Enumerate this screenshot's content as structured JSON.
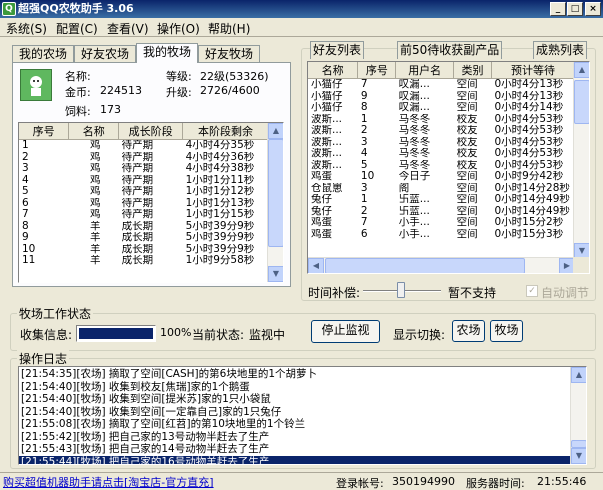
{
  "app": {
    "title": "超强QQ农牧助手 3.06",
    "title_buttons": [
      "_",
      "□",
      "×"
    ]
  },
  "menu": [
    "系统(S)",
    "配置(C)",
    "查看(V)",
    "操作(O)",
    "帮助(H)"
  ],
  "left_tabs": [
    "我的农场",
    "好友农场",
    "我的牧场",
    "好友牧场"
  ],
  "profile": {
    "name_label": "名称:",
    "name_value": "",
    "level_label": "等级:",
    "level_value": "22级(53326)",
    "gold_label": "金币:",
    "gold_value": "224513",
    "upgrade_label": "升级:",
    "upgrade_value": "2726/4600",
    "feed_label": "饲料:",
    "feed_value": "173"
  },
  "animals": {
    "headers": [
      "序号",
      "名称",
      "成长阶段",
      "本阶段剩余"
    ],
    "rows": [
      [
        "1",
        "鸡",
        "待产期",
        "4小时4分35秒"
      ],
      [
        "2",
        "鸡",
        "待产期",
        "4小时4分36秒"
      ],
      [
        "3",
        "鸡",
        "待产期",
        "4小时4分38秒"
      ],
      [
        "4",
        "鸡",
        "待产期",
        "1小时1分11秒"
      ],
      [
        "5",
        "鸡",
        "待产期",
        "1小时1分12秒"
      ],
      [
        "6",
        "鸡",
        "待产期",
        "1小时1分13秒"
      ],
      [
        "7",
        "鸡",
        "待产期",
        "1小时1分15秒"
      ],
      [
        "8",
        "羊",
        "成长期",
        "5小时39分9秒"
      ],
      [
        "9",
        "羊",
        "成长期",
        "5小时39分9秒"
      ],
      [
        "10",
        "羊",
        "成长期",
        "5小时39分9秒"
      ],
      [
        "11",
        "羊",
        "成长期",
        "1小时9分58秒"
      ]
    ]
  },
  "right_tabs": [
    "好友列表",
    "前50待收获副产品",
    "成熟列表"
  ],
  "friends": {
    "headers": [
      "名称",
      "序号",
      "用户名",
      "类别",
      "预计等待"
    ],
    "rows": [
      [
        "小猫仔",
        "7",
        "叹漏...",
        "空间",
        "0小时4分13秒"
      ],
      [
        "小猫仔",
        "9",
        "叹漏...",
        "空间",
        "0小时4分13秒"
      ],
      [
        "小猫仔",
        "8",
        "叹漏...",
        "空间",
        "0小时4分14秒"
      ],
      [
        "波斯...",
        "1",
        "马冬冬",
        "校友",
        "0小时4分53秒"
      ],
      [
        "波斯...",
        "2",
        "马冬冬",
        "校友",
        "0小时4分53秒"
      ],
      [
        "波斯...",
        "3",
        "马冬冬",
        "校友",
        "0小时4分53秒"
      ],
      [
        "波斯...",
        "4",
        "马冬冬",
        "校友",
        "0小时4分53秒"
      ],
      [
        "波斯...",
        "5",
        "马冬冬",
        "校友",
        "0小时4分53秒"
      ],
      [
        "鸡蛋",
        "10",
        "今日子",
        "空间",
        "0小时9分42秒"
      ],
      [
        "仓鼠崽",
        "3",
        "阁",
        "空间",
        "0小时14分28秒"
      ],
      [
        "兔仔",
        "1",
        "卐蓝...",
        "空间",
        "0小时14分49秒"
      ],
      [
        "兔仔",
        "2",
        "卐蓝...",
        "空间",
        "0小时14分49秒"
      ],
      [
        "鸡蛋",
        "7",
        "小手...",
        "空间",
        "0小时15分2秒"
      ],
      [
        "鸡蛋",
        "6",
        "小手...",
        "空间",
        "0小时15分3秒"
      ]
    ]
  },
  "time_comp": {
    "label": "时间补偿:",
    "value": "暂不支持",
    "auto_label": "自动调节",
    "auto_checked": true
  },
  "work": {
    "group_title": "牧场工作状态",
    "collect_label": "收集信息:",
    "progress_percent": 100,
    "progress_text": "100%",
    "status_label": "当前状态:",
    "status_value": "监视中",
    "stop_button": "停止监视",
    "display_label": "显示切换:",
    "farm_button": "农场",
    "ranch_button": "牧场"
  },
  "log": {
    "group_title": "操作日志",
    "lines": [
      "[21:54:35][农场] 摘取了空间[CASH]的第6块地里的1个胡萝卜",
      "[21:54:40][牧场] 收集到校友[焦瑞]家的1个鹅蛋",
      "[21:54:40][牧场] 收集到空间[提米苏]家的1只小袋鼠",
      "[21:54:40][牧场] 收集到空间[一定靠自己]家的1只兔仔",
      "[21:55:08][农场] 摘取了空间[红苕]的第10块地里的1个铃兰",
      "[21:55:42][牧场] 把自己家的13号动物半赶去了生产",
      "[21:55:43][牧场] 把自己家的14号动物半赶去了生产",
      "[21:55:44][牧场] 把自己家的16号动物羊赶去了生产"
    ],
    "selected_index": 7
  },
  "status_bar": {
    "ad_text": "购买超值机器助手请点击[淘宝店-官方直充]",
    "account_label": "登录帐号:",
    "account_value": "350194990",
    "server_time_label": "服务器时间:",
    "server_time_value": "21:55:46"
  }
}
